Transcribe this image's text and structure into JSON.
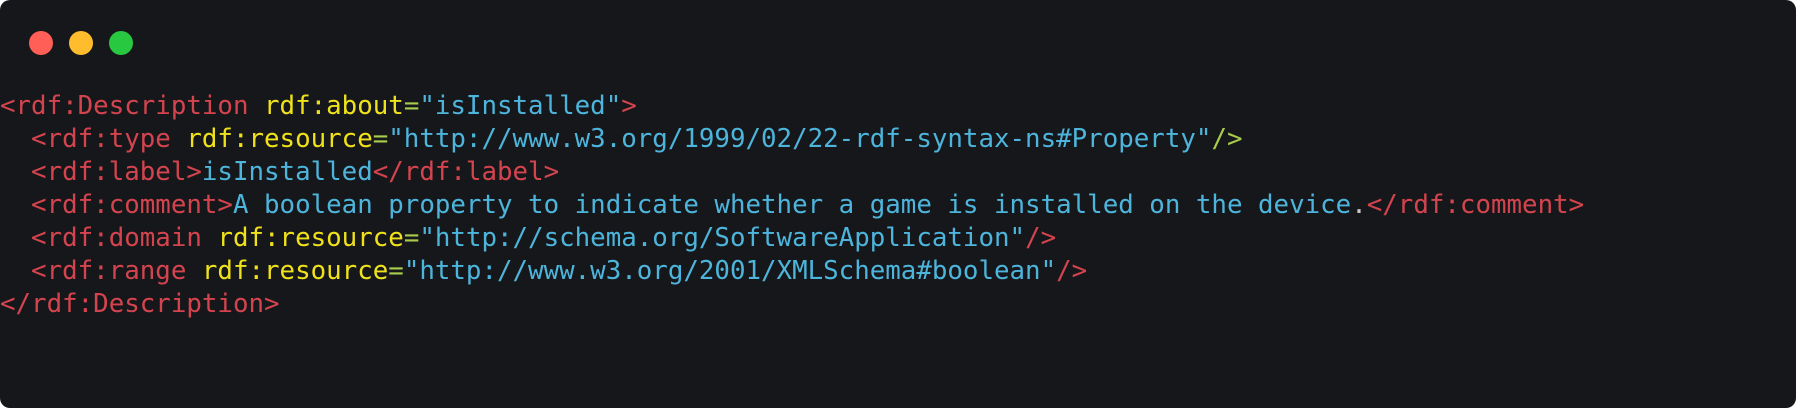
{
  "window": {
    "controls": [
      {
        "name": "close",
        "color": "#ff5f57"
      },
      {
        "name": "minimize",
        "color": "#ffbd2e"
      },
      {
        "name": "maximize",
        "color": "#28c840"
      }
    ]
  },
  "colors": {
    "background": "#16171a",
    "tag": "#d4444f",
    "attribute": "#f0e21a",
    "equals": "#a8cc4c",
    "string": "#4db5dc"
  },
  "code": {
    "lines": [
      [
        {
          "t": "tag",
          "v": "<rdf:Description "
        },
        {
          "t": "attr",
          "v": "rdf:about"
        },
        {
          "t": "eq",
          "v": "="
        },
        {
          "t": "str",
          "v": "\"isInstalled\""
        },
        {
          "t": "tag",
          "v": ">"
        }
      ],
      [
        {
          "t": "tag",
          "v": "  <rdf:type "
        },
        {
          "t": "attr",
          "v": "rdf:resource"
        },
        {
          "t": "eq",
          "v": "="
        },
        {
          "t": "str",
          "v": "\"http://www.w3.org/1999/02/22-rdf-syntax-ns#Property\""
        },
        {
          "t": "selfclose",
          "v": "/>"
        }
      ],
      [
        {
          "t": "tag",
          "v": "  <rdf:label>"
        },
        {
          "t": "text",
          "v": "isInstalled"
        },
        {
          "t": "tag",
          "v": "</rdf:label>"
        }
      ],
      [
        {
          "t": "tag",
          "v": "  <rdf:comment>"
        },
        {
          "t": "text",
          "v": "A boolean property to indicate whether a game is installed on the device"
        },
        {
          "t": "punct",
          "v": "."
        },
        {
          "t": "tag",
          "v": "</rdf:comment>"
        }
      ],
      [
        {
          "t": "tag",
          "v": "  <rdf:domain "
        },
        {
          "t": "attr",
          "v": "rdf:resource"
        },
        {
          "t": "eq",
          "v": "="
        },
        {
          "t": "str",
          "v": "\"http://schema.org/SoftwareApplication\""
        },
        {
          "t": "tag",
          "v": "/>"
        }
      ],
      [
        {
          "t": "tag",
          "v": "  <rdf:range "
        },
        {
          "t": "attr",
          "v": "rdf:resource"
        },
        {
          "t": "eq",
          "v": "="
        },
        {
          "t": "str",
          "v": "\"http://www.w3.org/2001/XMLSchema#boolean\""
        },
        {
          "t": "tag",
          "v": "/>"
        }
      ],
      [
        {
          "t": "tag",
          "v": "</rdf:Description>"
        }
      ]
    ]
  }
}
